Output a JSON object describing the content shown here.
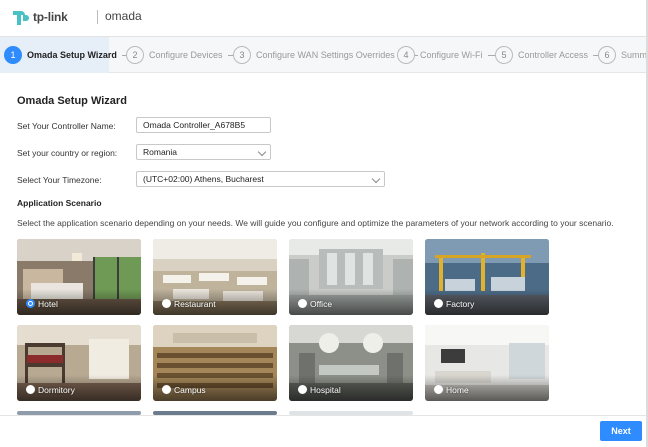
{
  "brand": {
    "tplink": "tp-link",
    "omada": "omada"
  },
  "steps": [
    {
      "num": "1",
      "label": "Omada Setup Wizard",
      "active": true
    },
    {
      "num": "2",
      "label": "Configure Devices",
      "active": false
    },
    {
      "num": "3",
      "label": "Configure WAN Settings Overrides",
      "active": false
    },
    {
      "num": "4",
      "label": "Configure Wi-Fi",
      "active": false
    },
    {
      "num": "5",
      "label": "Controller Access",
      "active": false
    },
    {
      "num": "6",
      "label": "Summa",
      "active": false
    }
  ],
  "page": {
    "title": "Omada Setup Wizard"
  },
  "form": {
    "controller_name_label": "Set Your Controller Name:",
    "controller_name_value": "Omada Controller_A678B5",
    "country_label": "Set your country or region:",
    "country_value": "Romania",
    "timezone_label": "Select Your Timezone:",
    "timezone_value": "(UTC+02:00) Athens, Bucharest"
  },
  "scenario": {
    "title": "Application Scenario",
    "description": "Select the application scenario depending on your needs. We will guide you configure and optimize the parameters of your network according to your scenario.",
    "options": [
      {
        "label": "Hotel",
        "selected": true
      },
      {
        "label": "Restaurant",
        "selected": false
      },
      {
        "label": "Office",
        "selected": false
      },
      {
        "label": "Factory",
        "selected": false
      },
      {
        "label": "Dormitory",
        "selected": false
      },
      {
        "label": "Campus",
        "selected": false
      },
      {
        "label": "Hospital",
        "selected": false
      },
      {
        "label": "Home",
        "selected": false
      }
    ]
  },
  "footer": {
    "next_label": "Next"
  },
  "colors": {
    "accent": "#2f8cff"
  }
}
